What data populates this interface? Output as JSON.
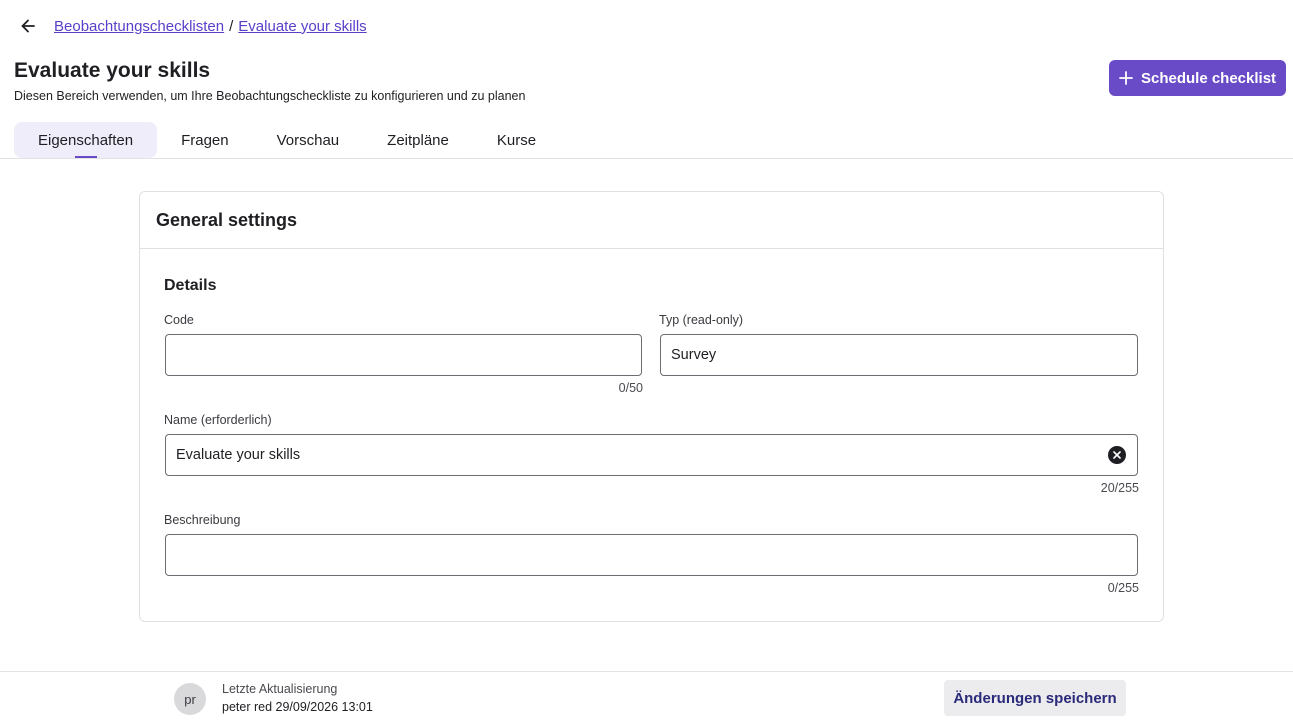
{
  "breadcrumb": {
    "items": [
      "Beobachtungschecklisten",
      "Evaluate your skills"
    ],
    "separator": "/"
  },
  "header": {
    "title": "Evaluate your skills",
    "subtitle": "Diesen Bereich verwenden, um Ihre Beobachtungscheckliste zu konfigurieren und zu planen",
    "schedule_label": "Schedule checklist"
  },
  "tabs": [
    {
      "label": "Eigenschaften",
      "active": true
    },
    {
      "label": "Fragen",
      "active": false
    },
    {
      "label": "Vorschau",
      "active": false
    },
    {
      "label": "Zeitpläne",
      "active": false
    },
    {
      "label": "Kurse",
      "active": false
    }
  ],
  "card": {
    "title": "General settings",
    "section_title": "Details",
    "fields": {
      "code": {
        "label": "Code",
        "value": "",
        "count": "0/50"
      },
      "type": {
        "label": "Typ (read-only)",
        "value": "Survey"
      },
      "name": {
        "label": "Name (erforderlich)",
        "value": "Evaluate your skills",
        "count": "20/255"
      },
      "description": {
        "label": "Beschreibung",
        "value": "",
        "count": "0/255"
      }
    }
  },
  "footer": {
    "avatar_initials": "pr",
    "update_label": "Letzte Aktualisierung",
    "update_info": "peter red 29/09/2026 13:01",
    "save_label": "Änderungen speichern"
  },
  "colors": {
    "accent": "#6a4bc7",
    "link": "#5b3fc8",
    "tab_active_bg": "#efedf9",
    "save_bg": "#ececef"
  },
  "icons": {
    "back": "arrow-left-icon",
    "plus": "plus-icon",
    "clear": "clear-circle-icon"
  }
}
